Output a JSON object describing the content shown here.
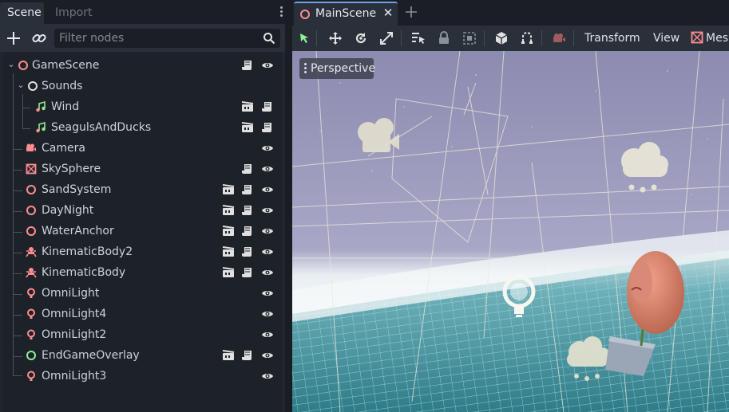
{
  "dock": {
    "tabs": [
      {
        "label": "Scene",
        "active": true
      },
      {
        "label": "Import",
        "active": false
      }
    ],
    "filter_placeholder": "Filter nodes",
    "icons": {
      "add": "add-node-icon",
      "link": "instance-child-scene-icon",
      "search": "search-icon",
      "menu": "vertical-dots-icon"
    }
  },
  "tree": {
    "nodes": [
      {
        "name": "GameScene",
        "icon": "node3d-circle-red",
        "expanded": true,
        "tools": [
          "script",
          "visibility"
        ]
      },
      {
        "name": "Sounds",
        "icon": "node-circle-white",
        "expanded": true,
        "tools": []
      },
      {
        "name": "Wind",
        "icon": "audio-stream-player-icon",
        "tools": [
          "instance",
          "script"
        ]
      },
      {
        "name": "SeagulsAndDucks",
        "icon": "audio-stream-player-icon",
        "tools": [
          "instance",
          "script"
        ]
      },
      {
        "name": "Camera",
        "icon": "camera-icon",
        "tools": [
          "visibility"
        ]
      },
      {
        "name": "SkySphere",
        "icon": "mesh-instance-icon",
        "tools": [
          "script",
          "visibility"
        ]
      },
      {
        "name": "SandSystem",
        "icon": "node3d-circle-red",
        "tools": [
          "instance",
          "script",
          "visibility"
        ]
      },
      {
        "name": "DayNight",
        "icon": "node3d-circle-red",
        "tools": [
          "instance",
          "script",
          "visibility"
        ]
      },
      {
        "name": "WaterAnchor",
        "icon": "node3d-circle-red",
        "tools": [
          "instance",
          "script",
          "visibility"
        ]
      },
      {
        "name": "KinematicBody2",
        "icon": "kinematic-body-icon",
        "tools": [
          "instance",
          "script",
          "visibility"
        ]
      },
      {
        "name": "KinematicBody",
        "icon": "kinematic-body-icon",
        "tools": [
          "instance",
          "script",
          "visibility"
        ]
      },
      {
        "name": "OmniLight",
        "icon": "omni-light-icon",
        "tools": [
          "visibility"
        ]
      },
      {
        "name": "OmniLight4",
        "icon": "omni-light-icon",
        "tools": [
          "visibility"
        ]
      },
      {
        "name": "OmniLight2",
        "icon": "omni-light-icon",
        "tools": [
          "visibility"
        ]
      },
      {
        "name": "EndGameOverlay",
        "icon": "node-circle-green",
        "tools": [
          "instance",
          "script",
          "visibility"
        ]
      },
      {
        "name": "OmniLight3",
        "icon": "omni-light-icon",
        "tools": [
          "visibility"
        ]
      }
    ]
  },
  "editor": {
    "scene_tab": {
      "label": "MainScene",
      "icon": "node3d-circle-red",
      "close_icon": "close-icon"
    },
    "new_tab_icon": "plus-icon",
    "toolbar": {
      "tools": [
        "select-icon",
        "move-icon",
        "rotate-icon",
        "scale-icon",
        "list-select-icon",
        "lock-icon",
        "group-icon",
        "local-space-icon",
        "snap-icon",
        "camera-preview-icon"
      ],
      "menus": {
        "transform": "Transform",
        "view": "View",
        "mesh": "Mesh"
      }
    },
    "viewport": {
      "mode_label": "Perspective",
      "colors": {
        "sky_top": "#8c8bb0",
        "sky_bottom": "#aaa9c8",
        "water": "#3e8b95",
        "grid": "#9ad6e0",
        "gizmo": "#ebe8d8",
        "body": "#e08470"
      }
    }
  },
  "colors": {
    "node3d": "#ff8c91",
    "node": "#e0e0e0",
    "audio": "#8ee88a",
    "control": "#8eef97",
    "accent": "#6fa1e8"
  }
}
